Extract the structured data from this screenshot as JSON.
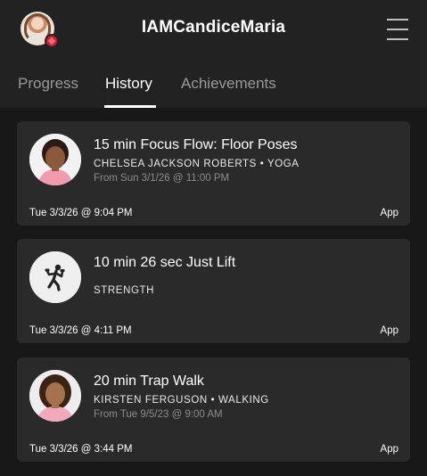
{
  "header": {
    "username": "IAMCandiceMaria"
  },
  "tabs": [
    {
      "label": "Progress",
      "active": false
    },
    {
      "label": "History",
      "active": true
    },
    {
      "label": "Achievements",
      "active": false
    }
  ],
  "history": [
    {
      "title": "15 min Focus Flow: Floor Poses",
      "subtitle": "CHELSEA JACKSON ROBERTS • YOGA",
      "from": "From Sun 3/1/26 @ 11:00 PM",
      "date": "Tue 3/3/26 @ 9:04 PM",
      "source": "App",
      "thumbnail": "instructor-photo"
    },
    {
      "title": "10 min 26 sec Just Lift",
      "subtitle": "STRENGTH",
      "from": "",
      "date": "Tue 3/3/26 @ 4:11 PM",
      "source": "App",
      "thumbnail": "strength-icon"
    },
    {
      "title": "20 min Trap Walk",
      "subtitle": "KIRSTEN FERGUSON • WALKING",
      "from": "From Tue 9/5/23 @ 9:00 AM",
      "date": "Tue 3/3/26 @ 3:44 PM",
      "source": "App",
      "thumbnail": "instructor-photo"
    }
  ]
}
